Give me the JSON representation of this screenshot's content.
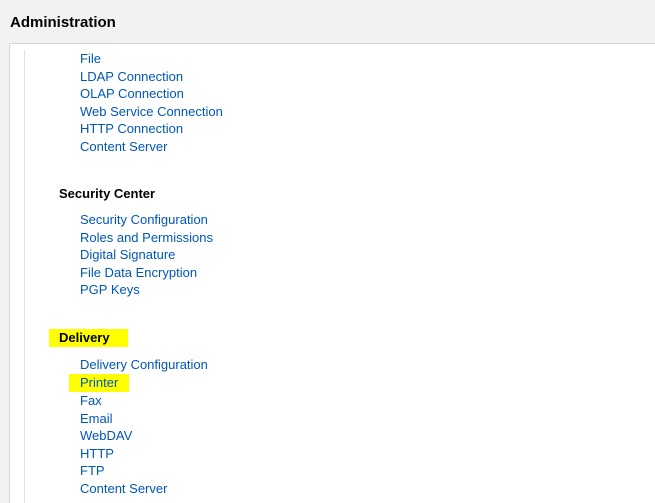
{
  "header": {
    "title": "Administration"
  },
  "partial_links": [
    "File",
    "LDAP Connection",
    "OLAP Connection",
    "Web Service Connection",
    "HTTP Connection",
    "Content Server"
  ],
  "sections": [
    {
      "heading": "Security Center",
      "highlight": false,
      "items": [
        {
          "label": "Security Configuration",
          "highlight": false
        },
        {
          "label": "Roles and Permissions",
          "highlight": false
        },
        {
          "label": "Digital Signature",
          "highlight": false
        },
        {
          "label": "File Data Encryption",
          "highlight": false
        },
        {
          "label": "PGP Keys",
          "highlight": false
        }
      ]
    },
    {
      "heading": "Delivery",
      "highlight": true,
      "items": [
        {
          "label": "Delivery Configuration",
          "highlight": false
        },
        {
          "label": "Printer",
          "highlight": true
        },
        {
          "label": "Fax",
          "highlight": false
        },
        {
          "label": "Email",
          "highlight": false
        },
        {
          "label": "WebDAV",
          "highlight": false
        },
        {
          "label": "HTTP",
          "highlight": false
        },
        {
          "label": "FTP",
          "highlight": false
        },
        {
          "label": "Content Server",
          "highlight": false
        }
      ]
    }
  ]
}
